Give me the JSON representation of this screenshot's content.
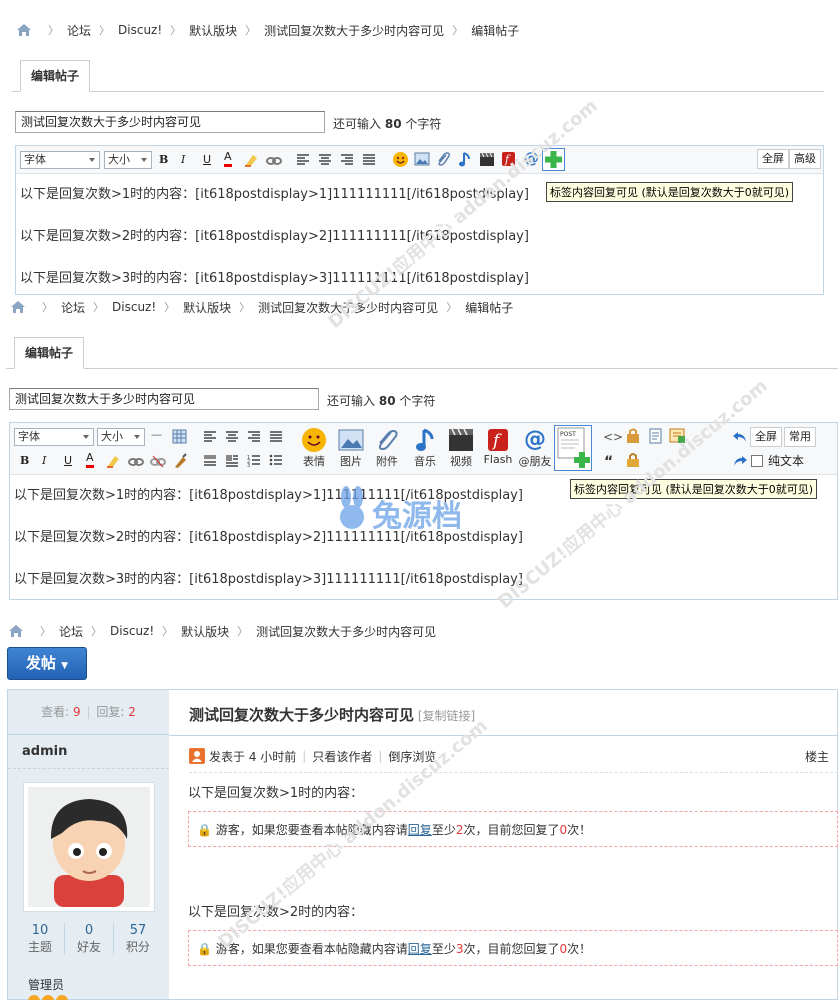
{
  "breadcrumb": [
    "论坛",
    "Discuz!",
    "默认版块",
    "测试回复次数大于多少时内容可见",
    "编辑帖子"
  ],
  "breadcrumb_view": [
    "论坛",
    "Discuz!",
    "默认版块",
    "测试回复次数大于多少时内容可见"
  ],
  "tab_label": "编辑帖子",
  "subject_value": "测试回复次数大于多少时内容可见",
  "remain": {
    "prefix": "还可输入",
    "count": "80",
    "suffix": "个字符"
  },
  "toolbar": {
    "font": "字体",
    "size": "大小",
    "bold": "B",
    "italic": "I",
    "underline": "U",
    "color": "A",
    "fullscreen": "全屏",
    "advanced": "高级",
    "common": "常用",
    "plaintext": "纯文本",
    "emotion": "表情",
    "image": "图片",
    "attach": "附件",
    "music": "音乐",
    "video": "视频",
    "flash": "Flash",
    "at": "@朋友"
  },
  "tooltip": "标签内容回复可见 (默认是回复次数大于0就可见)",
  "content_lines": [
    "以下是回复次数>1时的内容：[it618postdisplay>1]111111111[/it618postdisplay]",
    "以下是回复次数>2时的内容：[it618postdisplay>2]111111111[/it618postdisplay]",
    "以下是回复次数>3时的内容：[it618postdisplay>3]111111111[/it618postdisplay]"
  ],
  "post_button": "发帖",
  "stats": {
    "views_label": "查看:",
    "views": "9",
    "replies_label": "回复:",
    "replies": "2"
  },
  "thread_title": "测试回复次数大于多少时内容可见",
  "copy_link": "[复制链接]",
  "author": "admin",
  "post_meta": {
    "posted": "发表于 4 小时前",
    "only_author": "只看该作者",
    "reverse": "倒序浏览",
    "floor": "楼主"
  },
  "user_stats": [
    {
      "value": "10",
      "label": "主题"
    },
    {
      "value": "0",
      "label": "好友"
    },
    {
      "value": "57",
      "label": "积分"
    }
  ],
  "user_group": "管理员",
  "post_body": [
    {
      "text": "以下是回复次数>1时的内容：",
      "times": "2"
    },
    {
      "text": "以下是回复次数>2时的内容：",
      "times": "3"
    }
  ],
  "hide_msg": {
    "a": "游客，如果您要查看本帖隐藏内容请",
    "link": "回复",
    "b": "至少",
    "c": "次，目前您回复了",
    "replied": "0",
    "d": "次！"
  },
  "watermark": "DISCUZ!应用中心 addon.discuz.com",
  "watermark2": "兔源档"
}
